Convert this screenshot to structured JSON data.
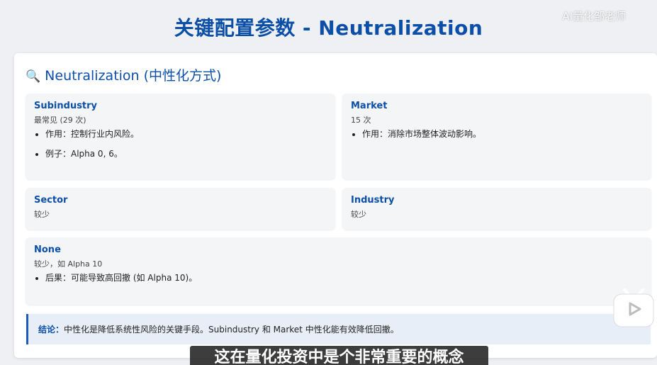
{
  "slide": {
    "title": "关键配置参数 - Neutralization",
    "watermark": "AI量化邹老师"
  },
  "card": {
    "icon": "magnifier-icon",
    "heading": "Neutralization (中性化方式)",
    "options": [
      {
        "name": "Subindustry",
        "note": "最常见 (29 次)",
        "bullets": [
          "作用：控制行业内风险。",
          "例子：Alpha 0, 6。"
        ]
      },
      {
        "name": "Market",
        "note": "15 次",
        "bullets": [
          "作用：消除市场整体波动影响。"
        ]
      },
      {
        "name": "Sector",
        "note": "较少",
        "bullets": []
      },
      {
        "name": "Industry",
        "note": "较少",
        "bullets": []
      },
      {
        "name": "None",
        "note": "较少，如 Alpha 10",
        "bullets": [
          "后果：可能导致高回撤 (如 Alpha 10)。"
        ]
      }
    ],
    "conclusion": {
      "label": "结论：",
      "text": "中性化是降低系统性风险的关键手段。Subindustry 和 Market 中性化能有效降低回撤。"
    }
  },
  "video_overlay": {
    "subtitle": "这在量化投资中是个非常重要的概念",
    "logo": "bilibili-tv-icon"
  },
  "colors": {
    "accent": "#0b4fa8",
    "conclusion_bg": "#e8eef8",
    "box_bg": "#f4f5f7"
  }
}
